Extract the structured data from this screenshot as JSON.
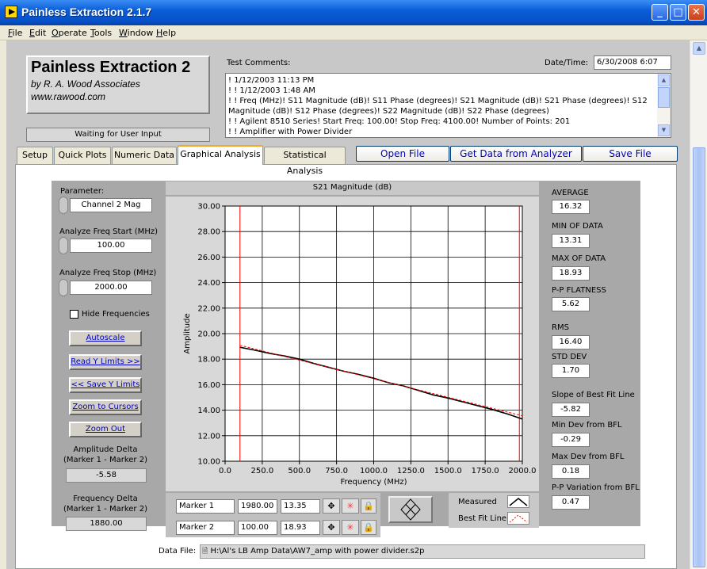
{
  "window": {
    "title": "Painless Extraction 2.1.7"
  },
  "menu": [
    "File",
    "Edit",
    "Operate",
    "Tools",
    "Window",
    "Help"
  ],
  "logo": {
    "title": "Painless Extraction 2",
    "company": "by R. A. Wood Associates",
    "website": "www.rawood.com"
  },
  "status": "Waiting for User Input",
  "comments": {
    "label": "Test Comments:",
    "lines": [
      "! 1/12/2003 11:13 PM",
      "! ! 1/12/2003 1:48 AM",
      "! ! Freq (MHz)! S11 Magnitude (dB)! S11 Phase (degrees)! S21 Magnitude (dB)! S21 Phase (degrees)! S12",
      "Magnitude (dB)! S12 Phase (degrees)! S22 Magnitude (dB)! S22 Phase (degrees)",
      "! ! Agilent 8510 Series! Start Freq: 100.00! Stop Freq: 4100.00! Number of Points: 201",
      "! ! Amplifier with Power Divider"
    ]
  },
  "datetime": {
    "label": "Date/Time:",
    "value": "6/30/2008  6:07"
  },
  "tabs": [
    "Setup",
    "Quick Plots",
    "Numeric Data",
    "Graphical Analysis",
    "Statistical Analysis"
  ],
  "active_tab": "Graphical Analysis",
  "actions": {
    "open": "Open File",
    "get": "Get Data from Analyzer",
    "save": "Save File"
  },
  "controls": {
    "parameter_label": "Parameter:",
    "parameter_value": "Channel 2 Mag",
    "start_label": "Analyze Freq Start (MHz)",
    "start_value": "100.00",
    "stop_label": "Analyze Freq Stop (MHz)",
    "stop_value": "2000.00",
    "hide_freq": "Hide Frequencies",
    "autoscale": "Autoscale",
    "read_y": "Read Y Limits >>",
    "save_y": "<< Save Y Limits",
    "zoom_cursors": "Zoom to Cursors",
    "zoom_out": "Zoom Out",
    "amp_delta_label1": "Amplitude Delta",
    "amp_delta_label2": "(Marker 1 - Marker 2)",
    "amp_delta_value": "-5.58",
    "freq_delta_label1": "Frequency Delta",
    "freq_delta_label2": "(Marker 1 - Marker 2)",
    "freq_delta_value": "1880.00"
  },
  "stats": [
    {
      "label": "AVERAGE",
      "value": "16.32"
    },
    {
      "label": "MIN OF DATA",
      "value": "13.31"
    },
    {
      "label": "MAX OF DATA",
      "value": "18.93"
    },
    {
      "label": "P-P FLATNESS",
      "value": "5.62"
    },
    {
      "label": "RMS",
      "value": "16.40"
    },
    {
      "label": "STD DEV",
      "value": "1.70"
    },
    {
      "label": "Slope of Best Fit Line",
      "value": "-5.82"
    },
    {
      "label": "Min Dev from BFL",
      "value": "-0.29"
    },
    {
      "label": "Max Dev from BFL",
      "value": "0.18"
    },
    {
      "label": "P-P Variation from BFL",
      "value": "0.47"
    }
  ],
  "markers": [
    {
      "name": "Marker 1",
      "freq": "1980.00",
      "amp": "13.35"
    },
    {
      "name": "Marker 2",
      "freq": "100.00",
      "amp": "18.93"
    }
  ],
  "legend": {
    "measured": "Measured",
    "bestfit": "Best Fit Line"
  },
  "datafile": {
    "label": "Data File:",
    "path": "H:\\Al's LB Amp Data\\AW7_amp with power divider.s2p"
  },
  "chart_data": {
    "type": "line",
    "title": "S21 Magnitude (dB)",
    "xlabel": "Frequency (MHz)",
    "ylabel": "Amplitude",
    "xlim": [
      0,
      2000
    ],
    "ylim": [
      10,
      30
    ],
    "xticks": [
      "0.0",
      "250.0",
      "500.0",
      "750.0",
      "1000.0",
      "1250.0",
      "1500.0",
      "1750.0",
      "2000.0"
    ],
    "yticks": [
      "10.00",
      "12.00",
      "14.00",
      "16.00",
      "18.00",
      "20.00",
      "22.00",
      "24.00",
      "26.00",
      "28.00",
      "30.00"
    ],
    "grid": true,
    "series": [
      {
        "name": "Measured",
        "color": "#000000",
        "x": [
          100,
          200,
          300,
          400,
          500,
          600,
          700,
          800,
          900,
          1000,
          1100,
          1200,
          1300,
          1400,
          1500,
          1600,
          1700,
          1800,
          1900,
          2000
        ],
        "y": [
          18.93,
          18.7,
          18.45,
          18.25,
          18.0,
          17.65,
          17.35,
          17.05,
          16.8,
          16.5,
          16.15,
          15.9,
          15.55,
          15.2,
          14.95,
          14.65,
          14.35,
          14.05,
          13.7,
          13.31
        ]
      },
      {
        "name": "Best Fit Line",
        "color": "#ff0000",
        "x": [
          100,
          2000
        ],
        "y": [
          19.09,
          13.56
        ]
      }
    ],
    "cursors": [
      {
        "x": 100,
        "color": "#ff0000"
      },
      {
        "x": 1980,
        "color": "#ff0000"
      }
    ]
  }
}
